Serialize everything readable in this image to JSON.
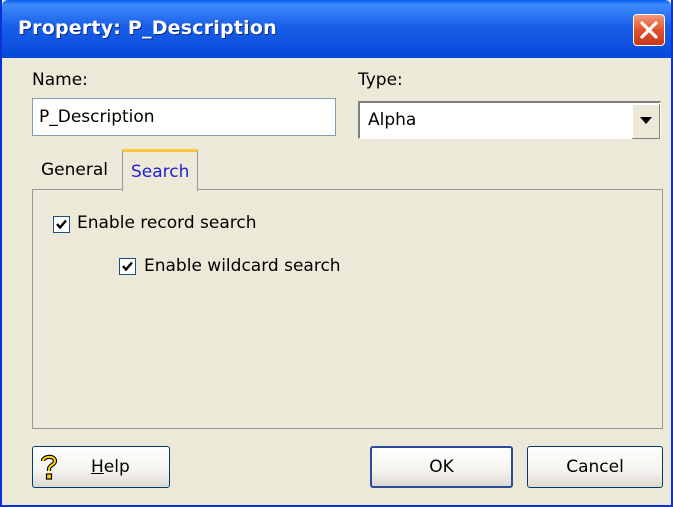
{
  "window": {
    "title": "Property:  P_Description"
  },
  "form": {
    "name_label": "Name:",
    "name_value": "P_Description",
    "type_label": "Type:",
    "type_value": "Alpha"
  },
  "tabs": [
    {
      "label": "General",
      "active": false
    },
    {
      "label": "Search",
      "active": true
    }
  ],
  "search_tab": {
    "enable_record_search": {
      "label": "Enable record search",
      "checked": true
    },
    "enable_wildcard_search": {
      "label": "Enable wildcard search",
      "checked": true
    }
  },
  "buttons": {
    "help_label_rest": "elp",
    "help_mnemonic": "H",
    "ok_label": "OK",
    "cancel_label": "Cancel"
  },
  "icons": {
    "close": "close-icon",
    "help": "help-icon",
    "dropdown": "chevron-down-icon",
    "check": "check-icon"
  }
}
